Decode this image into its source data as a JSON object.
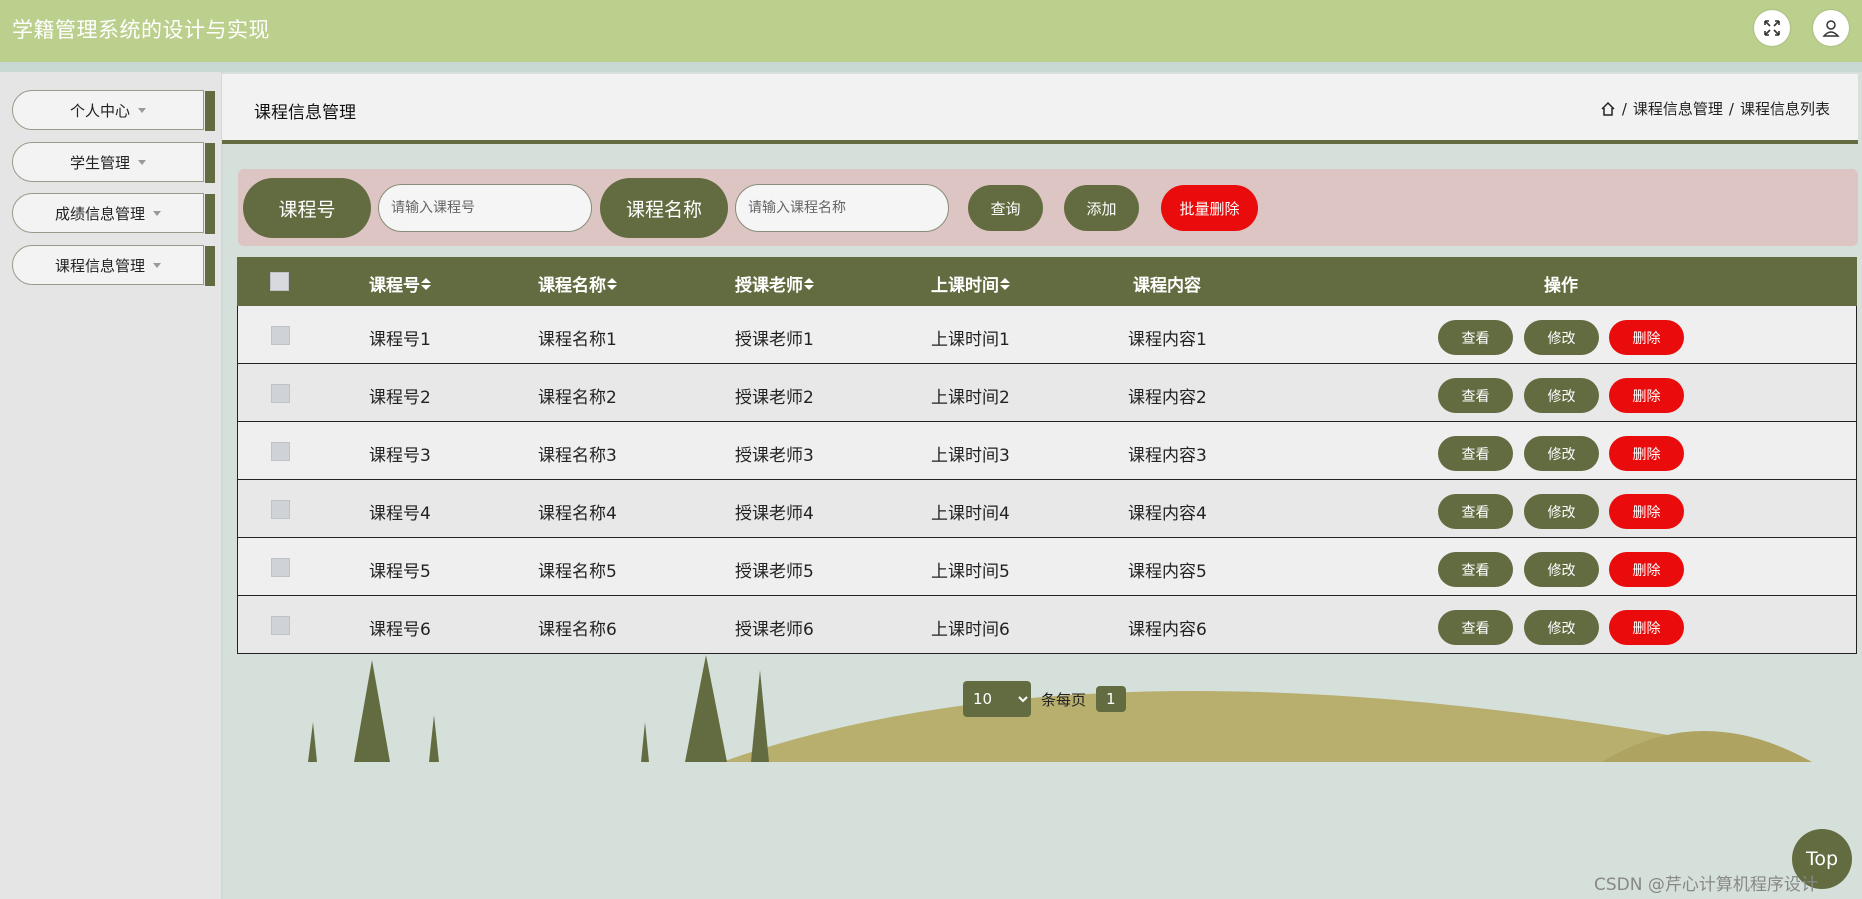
{
  "app": {
    "title": "学籍管理系统的设计与实现"
  },
  "header_icons": [
    "fullscreen-icon",
    "user-icon"
  ],
  "sidebar": {
    "items": [
      {
        "label": "个人中心"
      },
      {
        "label": "学生管理"
      },
      {
        "label": "成绩信息管理"
      },
      {
        "label": "课程信息管理"
      }
    ]
  },
  "page": {
    "title": "课程信息管理",
    "breadcrumb": [
      "课程信息管理",
      "课程信息列表"
    ]
  },
  "search": {
    "course_no_label": "课程号",
    "course_no_placeholder": "请输入课程号",
    "course_name_label": "课程名称",
    "course_name_placeholder": "请输入课程名称",
    "query_label": "查询",
    "add_label": "添加",
    "batch_delete_label": "批量删除"
  },
  "table": {
    "columns": [
      "课程号",
      "课程名称",
      "授课老师",
      "上课时间",
      "课程内容",
      "操作"
    ],
    "actions": {
      "view": "查看",
      "edit": "修改",
      "delete": "删除"
    },
    "rows": [
      {
        "course_no": "课程号1",
        "course_name": "课程名称1",
        "teacher": "授课老师1",
        "time": "上课时间1",
        "content": "课程内容1"
      },
      {
        "course_no": "课程号2",
        "course_name": "课程名称2",
        "teacher": "授课老师2",
        "time": "上课时间2",
        "content": "课程内容2"
      },
      {
        "course_no": "课程号3",
        "course_name": "课程名称3",
        "teacher": "授课老师3",
        "time": "上课时间3",
        "content": "课程内容3"
      },
      {
        "course_no": "课程号4",
        "course_name": "课程名称4",
        "teacher": "授课老师4",
        "time": "上课时间4",
        "content": "课程内容4"
      },
      {
        "course_no": "课程号5",
        "course_name": "课程名称5",
        "teacher": "授课老师5",
        "time": "上课时间5",
        "content": "课程内容5"
      },
      {
        "course_no": "课程号6",
        "course_name": "课程名称6",
        "teacher": "授课老师6",
        "time": "上课时间6",
        "content": "课程内容6"
      }
    ]
  },
  "pagination": {
    "page_size": "10",
    "per_page_label": "条每页",
    "current_page": "1"
  },
  "top_button": "Top",
  "watermark": "CSDN @芹心计算机程序设计",
  "colors": {
    "header": "#bcd08e",
    "accent": "#636c40",
    "danger": "#ea0c0c",
    "search_bg": "#dcc5c2"
  }
}
